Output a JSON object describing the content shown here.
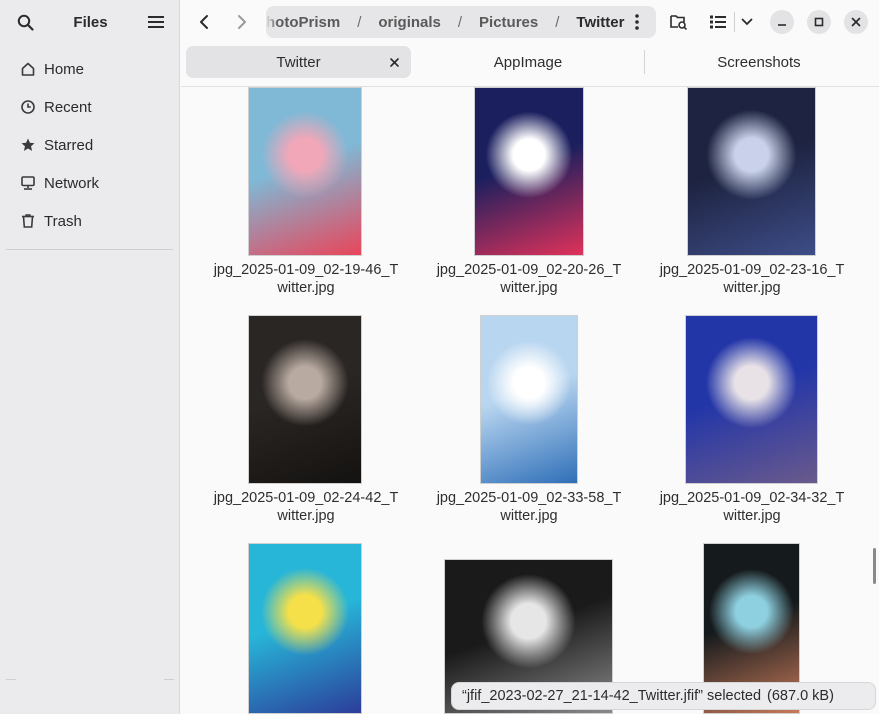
{
  "app": {
    "title": "Files"
  },
  "sidebar": {
    "items": [
      {
        "label": "Home",
        "icon": "home-icon"
      },
      {
        "label": "Recent",
        "icon": "clock-icon"
      },
      {
        "label": "Starred",
        "icon": "star-icon"
      },
      {
        "label": "Network",
        "icon": "network-icon"
      },
      {
        "label": "Trash",
        "icon": "trash-icon"
      }
    ]
  },
  "path": {
    "crumbs": [
      "hotoPrism",
      "originals",
      "Pictures",
      "Twitter"
    ]
  },
  "tabs": [
    {
      "label": "Twitter",
      "active": true
    },
    {
      "label": "AppImage",
      "active": false
    },
    {
      "label": "Screenshots",
      "active": false
    }
  ],
  "files": [
    {
      "line1": "jpg_2025-01-09_02-19-46_T",
      "line2": "witter.jpg",
      "colors": [
        "#7fb9d6",
        "#f2a7b8",
        "#e8455a"
      ]
    },
    {
      "line1": "jpg_2025-01-09_02-20-26_T",
      "line2": "witter.jpg",
      "colors": [
        "#1b1f5e",
        "#ffffff",
        "#e0325a"
      ]
    },
    {
      "line1": "jpg_2025-01-09_02-23-16_T",
      "line2": "witter.jpg",
      "colors": [
        "#1d2340",
        "#c9d2ea",
        "#3e4d88"
      ]
    },
    {
      "line1": "jpg_2025-01-09_02-24-42_T",
      "line2": "witter.jpg",
      "colors": [
        "#2a2624",
        "#b8aaa0",
        "#141210"
      ]
    },
    {
      "line1": "jpg_2025-01-09_02-33-58_T",
      "line2": "witter.jpg",
      "colors": [
        "#b9d6f0",
        "#ffffff",
        "#2f6fb8"
      ]
    },
    {
      "line1": "jpg_2025-01-09_02-34-32_T",
      "line2": "witter.jpg",
      "colors": [
        "#2336a8",
        "#e8e2e6",
        "#6a5a8c"
      ]
    },
    {
      "line1": "",
      "line2": "",
      "colors": [
        "#27b5d8",
        "#f5e04a",
        "#2c3d9a"
      ]
    },
    {
      "line1": "",
      "line2": "",
      "colors": [
        "#1a1a1a",
        "#e6e6e6",
        "#8a8a8a"
      ]
    },
    {
      "line1": "",
      "line2": "",
      "colors": [
        "#151a1c",
        "#8fd0e0",
        "#c97a5a"
      ]
    }
  ],
  "status": {
    "selected": "“jfif_2023-02-27_21-14-42_Twitter.jfif” selected",
    "size": "(687.0 kB)"
  },
  "colors": {
    "sidebar_bg": "#ebebed",
    "content_bg": "#fafafa",
    "accent": "#e3e3e5"
  }
}
